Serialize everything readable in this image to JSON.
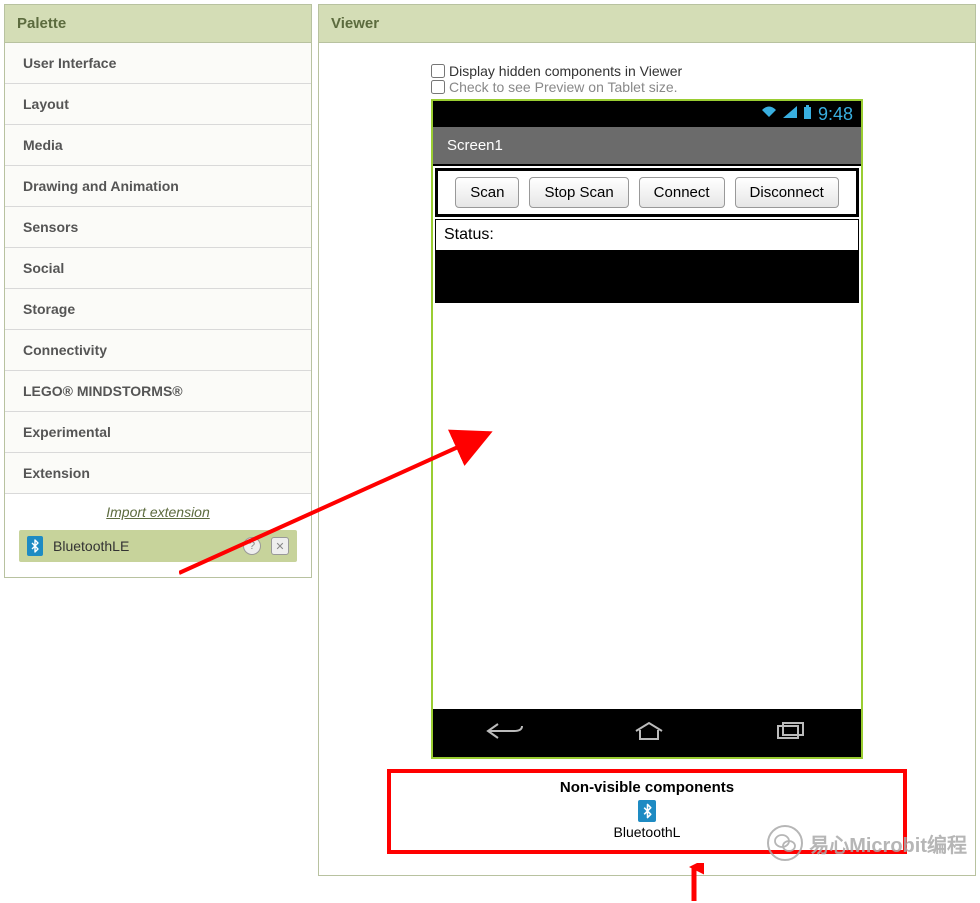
{
  "palette": {
    "title": "Palette",
    "categories": [
      "User Interface",
      "Layout",
      "Media",
      "Drawing and Animation",
      "Sensors",
      "Social",
      "Storage",
      "Connectivity",
      "LEGO® MINDSTORMS®",
      "Experimental",
      "Extension"
    ],
    "import_link": "Import extension",
    "component": {
      "name": "BluetoothLE",
      "icon": "bluetooth"
    }
  },
  "viewer": {
    "title": "Viewer",
    "check_hidden": "Display hidden components in Viewer",
    "check_tablet": "Check to see Preview on Tablet size.",
    "phone": {
      "time": "9:48",
      "screen_title": "Screen1",
      "buttons": [
        "Scan",
        "Stop Scan",
        "Connect",
        "Disconnect"
      ],
      "status_label": "Status:"
    },
    "nonvisible": {
      "title": "Non-visible components",
      "item": "BluetoothL"
    }
  },
  "watermark": "易心Microbit编程"
}
